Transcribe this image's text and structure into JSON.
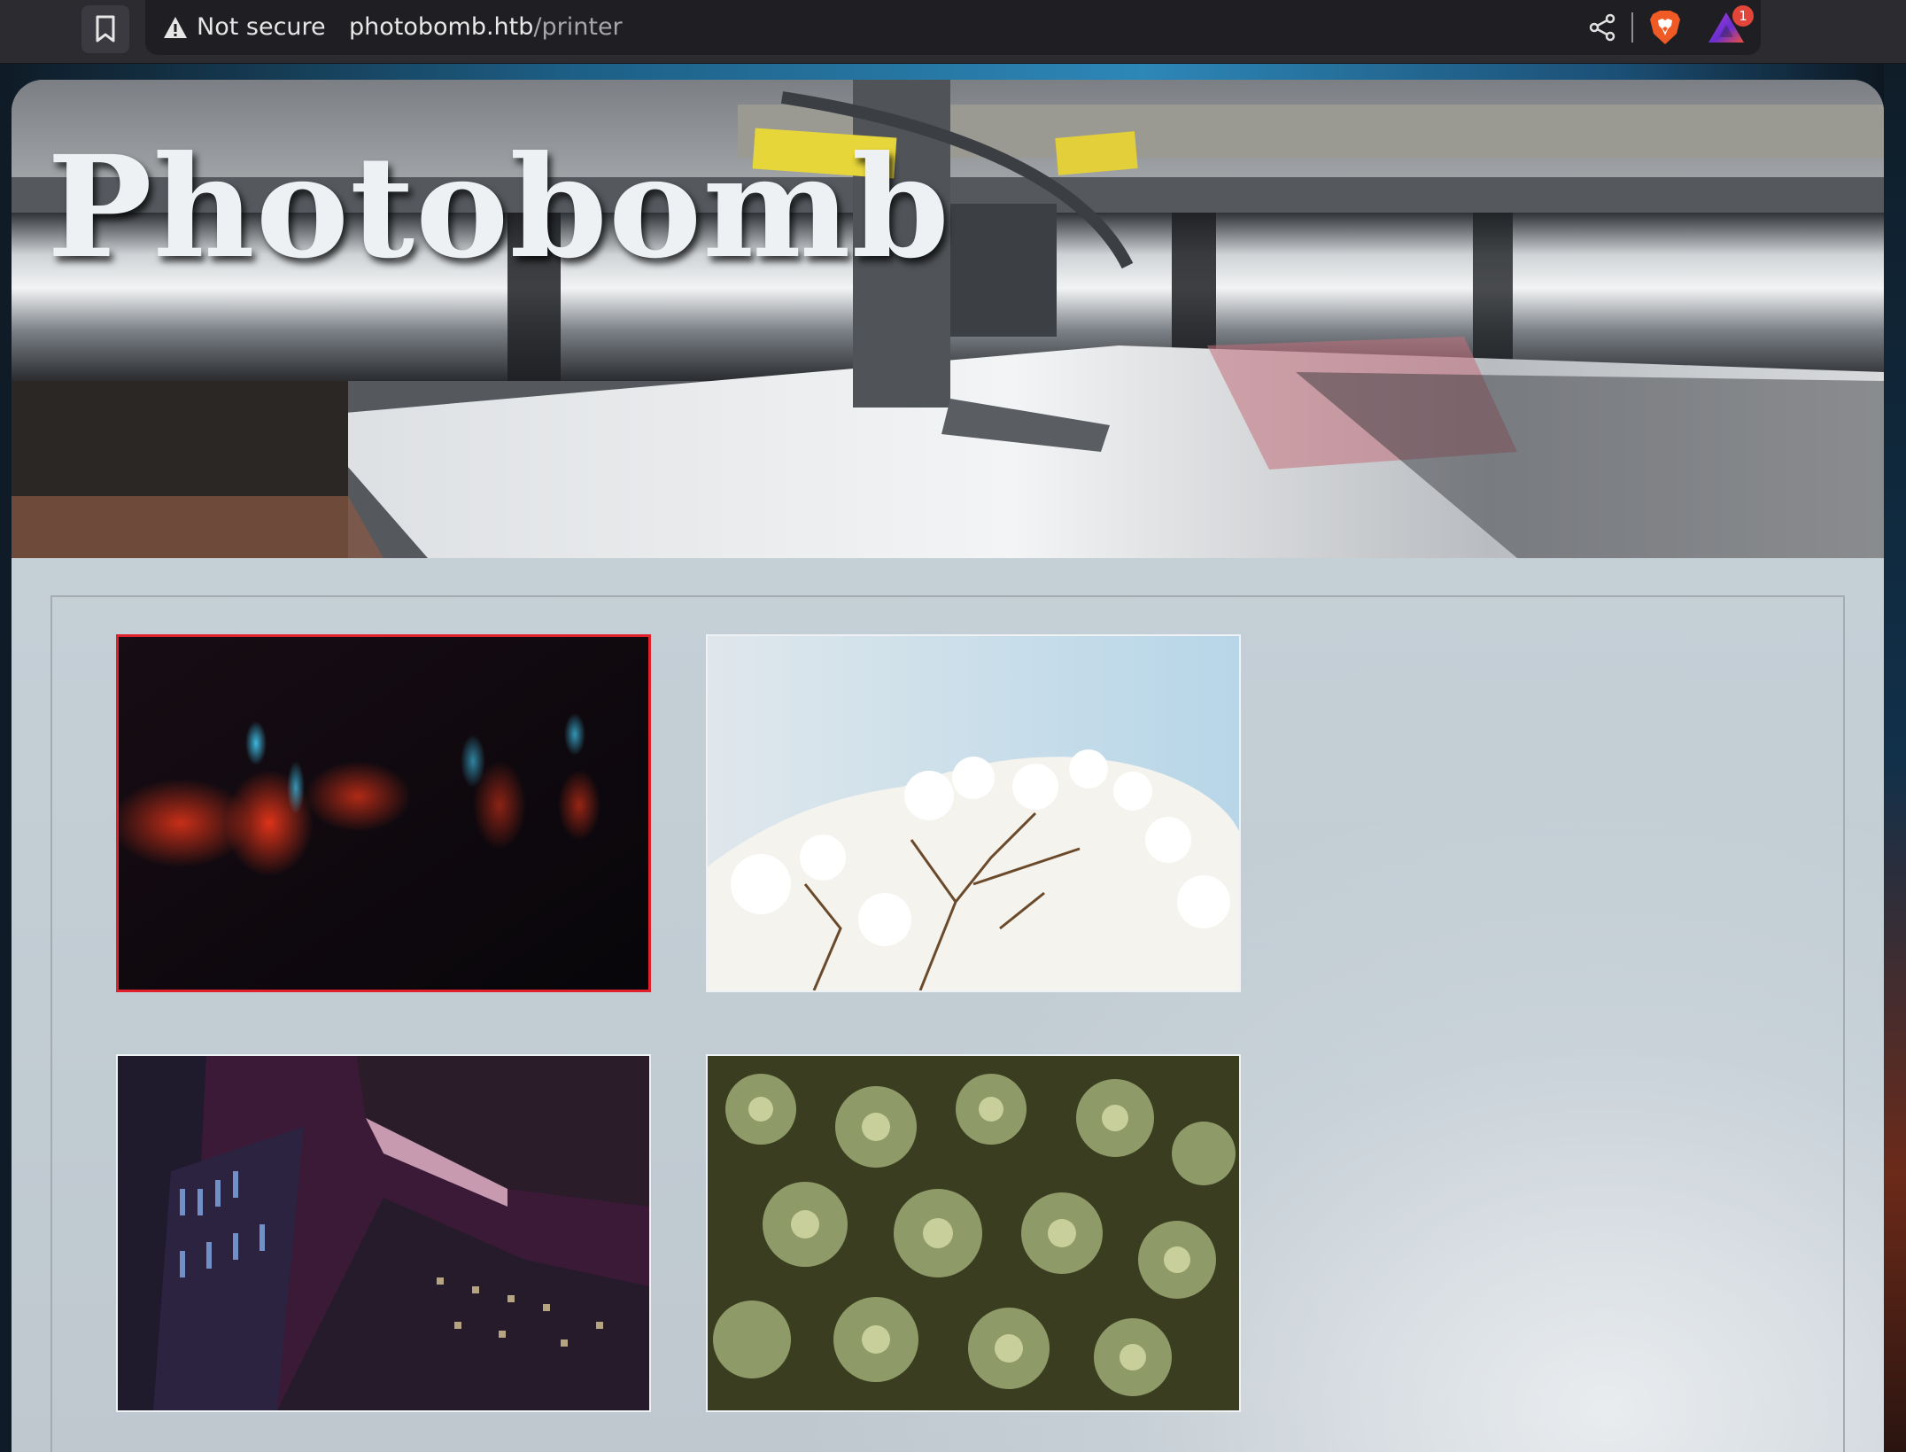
{
  "browser": {
    "security_label": "Not secure",
    "url_host": "photobomb.htb",
    "url_path": "/printer",
    "rewards_badge": "1",
    "icons": [
      "bookmark-icon",
      "warning-icon",
      "share-icon",
      "brave-shield-icon",
      "brave-rewards-icon"
    ]
  },
  "page": {
    "title": "Photobomb",
    "banner_image": "printing-press",
    "selected_color": "#e0202a",
    "photos": [
      {
        "subject": "neon-blur",
        "selected": true
      },
      {
        "subject": "white-blossoms",
        "selected": false
      },
      {
        "subject": "skyscrapers",
        "selected": false
      },
      {
        "subject": "succulents",
        "selected": false
      }
    ]
  }
}
